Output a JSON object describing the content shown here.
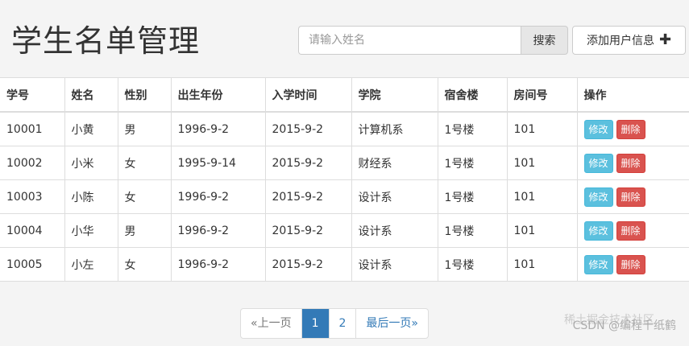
{
  "header": {
    "title": "学生名单管理",
    "search_placeholder": "请输入姓名",
    "search_label": "搜索",
    "add_label": "添加用户信息"
  },
  "table": {
    "columns": [
      "学号",
      "姓名",
      "性别",
      "出生年份",
      "入学时间",
      "学院",
      "宿舍楼",
      "房间号",
      "操作"
    ],
    "rows": [
      {
        "id": "10001",
        "name": "小黄",
        "gender": "男",
        "birth": "1996-9-2",
        "enroll": "2015-9-2",
        "college": "计算机系",
        "dorm": "1号楼",
        "room": "101"
      },
      {
        "id": "10002",
        "name": "小米",
        "gender": "女",
        "birth": "1995-9-14",
        "enroll": "2015-9-2",
        "college": "财经系",
        "dorm": "1号楼",
        "room": "101"
      },
      {
        "id": "10003",
        "name": "小陈",
        "gender": "女",
        "birth": "1996-9-2",
        "enroll": "2015-9-2",
        "college": "设计系",
        "dorm": "1号楼",
        "room": "101"
      },
      {
        "id": "10004",
        "name": "小华",
        "gender": "男",
        "birth": "1996-9-2",
        "enroll": "2015-9-2",
        "college": "设计系",
        "dorm": "1号楼",
        "room": "101"
      },
      {
        "id": "10005",
        "name": "小左",
        "gender": "女",
        "birth": "1996-9-2",
        "enroll": "2015-9-2",
        "college": "设计系",
        "dorm": "1号楼",
        "room": "101"
      }
    ],
    "edit_label": "修改",
    "delete_label": "删除"
  },
  "pagination": {
    "prev": "«上一页",
    "pages": [
      "1",
      "2"
    ],
    "active": "1",
    "last": "最后一页»"
  },
  "watermark": "CSDN @编程千纸鹤",
  "watermark2": "稀土掘金技术社区",
  "colors": {
    "edit": "#5bc0de",
    "delete": "#d9534f",
    "primary": "#337ab7"
  }
}
